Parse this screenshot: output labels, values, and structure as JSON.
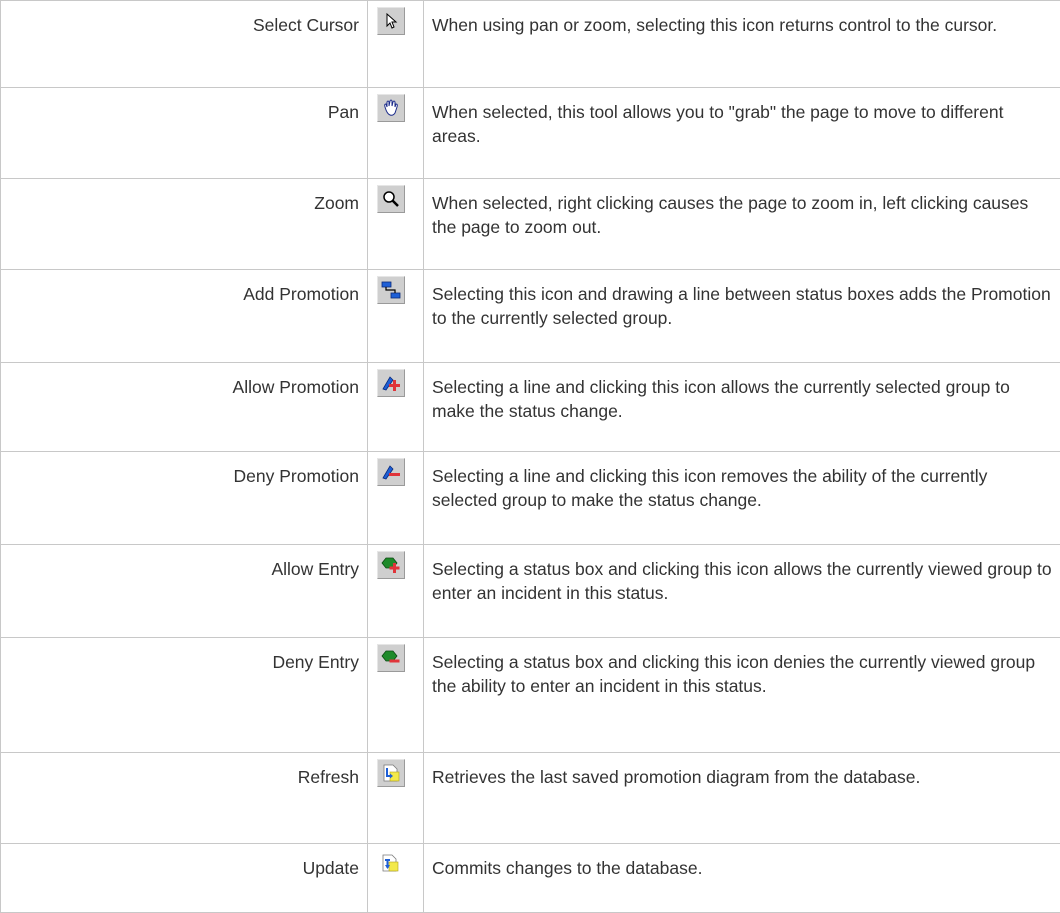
{
  "tools": [
    {
      "name": "Select Cursor",
      "icon": "select-cursor-icon",
      "description": "When using pan or zoom, selecting this icon returns control to the cursor."
    },
    {
      "name": "Pan",
      "icon": "pan-hand-icon",
      "description": "When selected, this tool allows you to \"grab\" the page to move to different areas."
    },
    {
      "name": "Zoom",
      "icon": "zoom-magnifier-icon",
      "description": "When selected, right clicking causes the page to zoom in, left clicking causes the page to zoom out."
    },
    {
      "name": "Add Promotion",
      "icon": "add-promotion-icon",
      "description": "Selecting this icon and drawing a line between status boxes adds the Promotion to the currently selected group."
    },
    {
      "name": "Allow Promotion",
      "icon": "allow-promotion-icon",
      "description": "Selecting a line and clicking this icon allows the currently selected group to make the status change."
    },
    {
      "name": "Deny Promotion",
      "icon": "deny-promotion-icon",
      "description": "Selecting a line and clicking this icon removes the ability of the currently selected group to make the status change."
    },
    {
      "name": "Allow Entry",
      "icon": "allow-entry-icon",
      "description": "Selecting a status box and clicking this icon allows the currently viewed group to enter an incident in this status."
    },
    {
      "name": "Deny Entry",
      "icon": "deny-entry-icon",
      "description": "Selecting a status box and clicking this icon denies the currently viewed group the ability to enter an incident in this status."
    },
    {
      "name": "Refresh",
      "icon": "refresh-icon",
      "description": "Retrieves the last saved promotion diagram from the database."
    },
    {
      "name": "Update",
      "icon": "update-icon",
      "description": "Commits changes to the database."
    }
  ],
  "colors": {
    "border": "#c8c8c8",
    "text": "#333333",
    "button_face": "#cfcfcf",
    "add_plus": "#e0343a",
    "entry_green": "#1f8a2a",
    "promo_blue": "#1e5fd6",
    "doc_yellow": "#f3e94a"
  }
}
